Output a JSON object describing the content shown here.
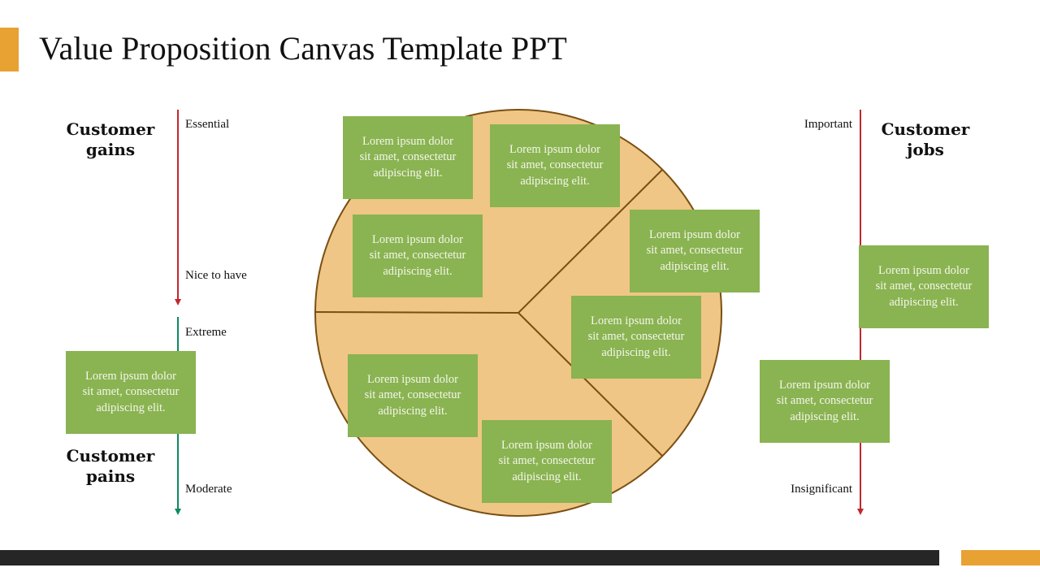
{
  "header": {
    "title": "Value Proposition Canvas Template PPT"
  },
  "colors": {
    "accent": "#E8A133",
    "footer_dark": "#262626",
    "card_green": "#8AB351",
    "circle_fill": "#EFC686",
    "circle_stroke": "#7A4F12",
    "arrow_red": "#C0272D",
    "arrow_green": "#0E8A5F"
  },
  "left": {
    "gains": {
      "heading_line1": "Customer",
      "heading_line2": "gains",
      "top_label": "Essential",
      "bottom_label": "Nice to have"
    },
    "pains": {
      "heading_line1": "Customer",
      "heading_line2": "pains",
      "top_label": "Extreme",
      "bottom_label": "Moderate",
      "card": {
        "line1": "Lorem ipsum dolor",
        "line2": "sit amet, consectetur",
        "line3": "adipiscing elit."
      }
    }
  },
  "right": {
    "jobs": {
      "heading_line1": "Customer",
      "heading_line2": "jobs",
      "top_label": "Important",
      "bottom_label": "Insignificant",
      "cards": [
        {
          "line1": "Lorem ipsum dolor",
          "line2": "sit amet, consectetur",
          "line3": "adipiscing elit."
        },
        {
          "line1": "Lorem ipsum dolor",
          "line2": "sit amet, consectetur",
          "line3": "adipiscing elit."
        }
      ]
    }
  },
  "circle": {
    "segments": 3,
    "cards": [
      {
        "line1": "Lorem ipsum dolor",
        "line2": "sit amet, consectetur",
        "line3": "adipiscing elit."
      },
      {
        "line1": "Lorem ipsum dolor",
        "line2": "sit amet, consectetur",
        "line3": "adipiscing elit."
      },
      {
        "line1": "Lorem ipsum dolor",
        "line2": "sit amet, consectetur",
        "line3": "adipiscing elit."
      },
      {
        "line1": "Lorem ipsum dolor",
        "line2": "sit amet, consectetur",
        "line3": "adipiscing elit."
      },
      {
        "line1": "Lorem ipsum dolor",
        "line2": "sit amet, consectetur",
        "line3": "adipiscing elit."
      },
      {
        "line1": "Lorem ipsum dolor",
        "line2": "sit amet, consectetur",
        "line3": "adipiscing elit."
      },
      {
        "line1": "Lorem ipsum dolor",
        "line2": "sit amet, consectetur",
        "line3": "adipiscing elit."
      }
    ]
  }
}
